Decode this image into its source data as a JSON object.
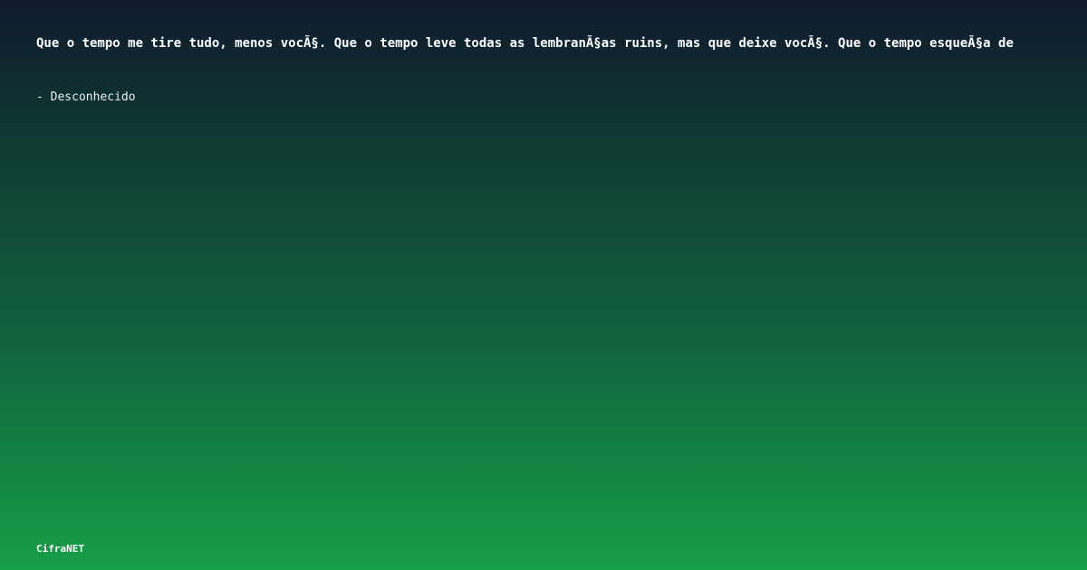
{
  "quote": {
    "text": "Que o tempo me tire tudo, menos vocÃ§. Que o tempo leve todas as lembranÃ§as ruins, mas que deixe vocÃ§. Que o tempo esqueÃ§a de",
    "author": "- Desconhecido"
  },
  "brand": {
    "name": "CifraNET"
  },
  "colors": {
    "gradient_top": "#0f1a2e",
    "gradient_bottom": "#169e47",
    "text": "#ffffff"
  }
}
